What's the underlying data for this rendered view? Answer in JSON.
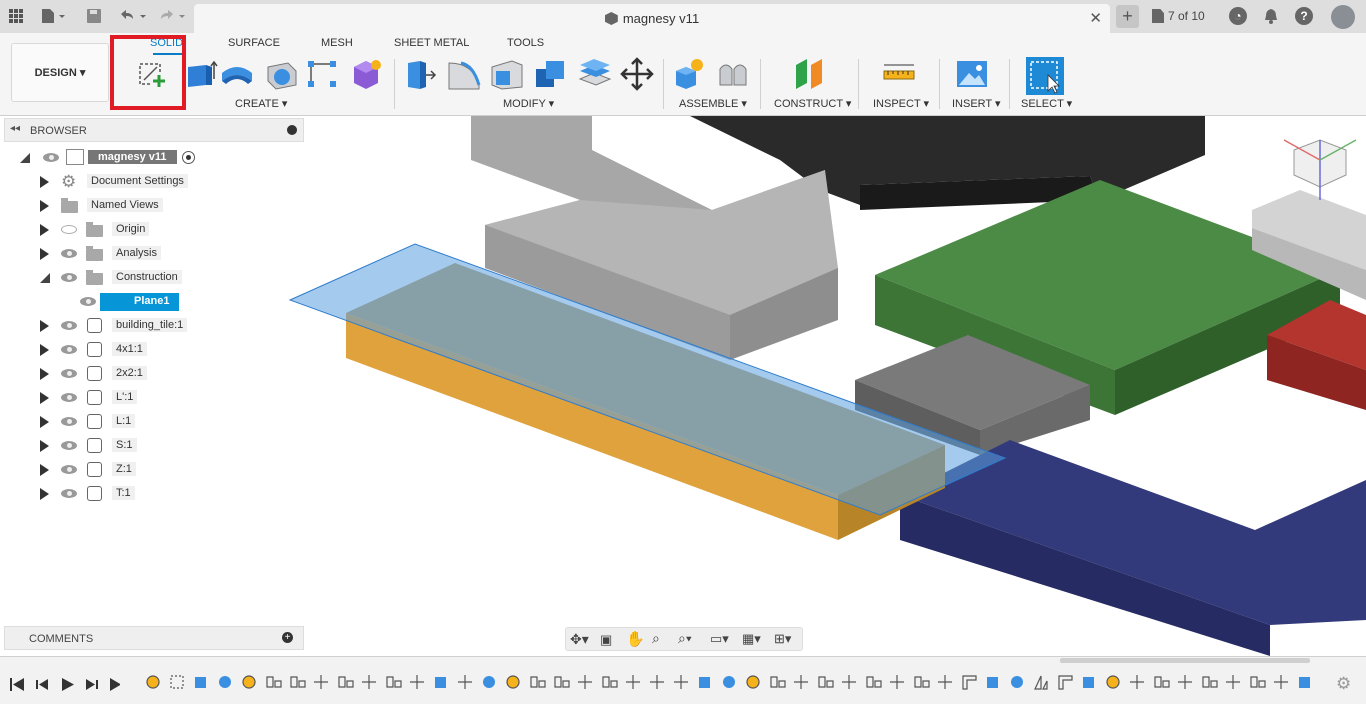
{
  "titlebar": {
    "document_title": "magnesy v11",
    "version": "7 of 10"
  },
  "toolbar": {
    "workspace_button": "DESIGN ▾",
    "tabs": [
      {
        "label": "SOLID",
        "active": true
      },
      {
        "label": "SURFACE"
      },
      {
        "label": "MESH"
      },
      {
        "label": "SHEET METAL"
      },
      {
        "label": "TOOLS"
      }
    ],
    "groups": {
      "create": "CREATE ▾",
      "modify": "MODIFY ▾",
      "assemble": "ASSEMBLE ▾",
      "construct": "CONSTRUCT ▾",
      "inspect": "INSPECT ▾",
      "insert": "INSERT ▾",
      "select": "SELECT ▾"
    }
  },
  "browser": {
    "title": "BROWSER",
    "root": "magnesy v11",
    "items": [
      {
        "label": "Document Settings"
      },
      {
        "label": "Named Views"
      },
      {
        "label": "Origin"
      },
      {
        "label": "Analysis"
      },
      {
        "label": "Construction"
      },
      {
        "label": "Plane1"
      },
      {
        "label": "building_tile:1"
      },
      {
        "label": "4x1:1"
      },
      {
        "label": "2x2:1"
      },
      {
        "label": "L':1"
      },
      {
        "label": "L:1"
      },
      {
        "label": "S:1"
      },
      {
        "label": "Z:1"
      },
      {
        "label": "T:1"
      }
    ]
  },
  "comments": {
    "title": "COMMENTS"
  },
  "colors": {
    "accent": "#0a7cc4",
    "highlight": "#e01b24",
    "selected_row": "#0696d7"
  }
}
